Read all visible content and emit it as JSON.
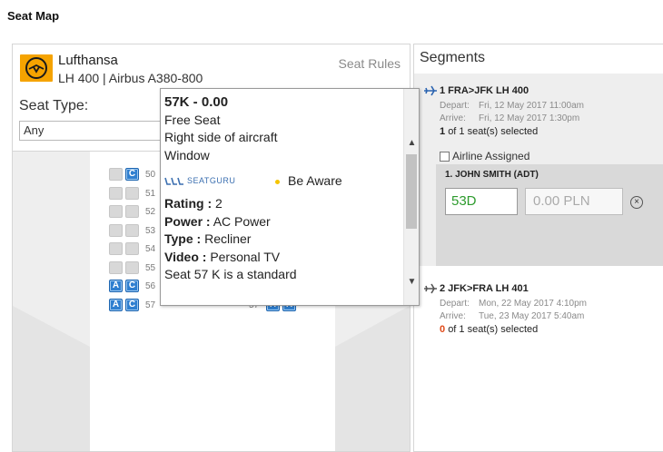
{
  "page": {
    "title": "Seat Map"
  },
  "flight": {
    "airline": "Lufthansa",
    "flight_info": "LH 400 | Airbus A380-800",
    "seat_rules_label": "Seat Rules",
    "seat_type_label": "Seat Type:",
    "seat_type_value": "Any"
  },
  "seatmap": {
    "rows": [
      {
        "num": "50",
        "left": [
          "",
          "C"
        ],
        "right": []
      },
      {
        "num": "51",
        "left": [
          "",
          ""
        ],
        "right": []
      },
      {
        "num": "52",
        "left": [
          "",
          ""
        ],
        "right": []
      },
      {
        "num": "53",
        "left": [
          "",
          ""
        ],
        "right": []
      },
      {
        "num": "54",
        "left": [
          "",
          ""
        ],
        "right": []
      },
      {
        "num": "55",
        "left": [
          "",
          ""
        ],
        "right": []
      },
      {
        "num": "56",
        "left": [
          "A",
          "C"
        ],
        "right": []
      },
      {
        "num": "57",
        "left": [
          "A",
          "C"
        ],
        "right": [
          "H",
          "K"
        ]
      }
    ]
  },
  "tooltip": {
    "title": "57K - 0.00",
    "lines": [
      "Free Seat",
      "Right side of aircraft",
      "Window"
    ],
    "seatguru_logo": "SEATGURU",
    "awareness": "Be Aware",
    "rating_label": "Rating :",
    "rating_value": "2",
    "power_label": "Power :",
    "power_value": "AC Power",
    "type_label": "Type :",
    "type_value": "Recliner",
    "video_label": "Video :",
    "video_value": "Personal TV",
    "description": "Seat 57 K is a standard"
  },
  "segments": {
    "title": "Segments",
    "items": [
      {
        "heading": "1 FRA>JFK LH 400",
        "depart_label": "Depart:",
        "depart_value": "Fri, 12 May 2017 11:00am",
        "arrive_label": "Arrive:",
        "arrive_value": "Fri, 12 May 2017 1:30pm",
        "selected_count": "1",
        "of_total": "of 1 seat(s) selected",
        "airline_assigned": "Airline Assigned",
        "passenger": "1. JOHN SMITH  (ADT)",
        "seat_value": "53D",
        "price_value": "0.00 PLN"
      },
      {
        "heading": "2 JFK>FRA LH 401",
        "depart_label": "Depart:",
        "depart_value": "Mon, 22 May 2017 4:10pm",
        "arrive_label": "Arrive:",
        "arrive_value": "Tue, 23 May 2017 5:40am",
        "selected_count": "0",
        "of_total": "of 1 seat(s) selected"
      }
    ]
  },
  "colors": {
    "brand_orange": "#f5a300",
    "seat_available": "#2f7fd0",
    "seat_selected_text": "#2d9b2d",
    "zero_count": "#e04b1a"
  }
}
